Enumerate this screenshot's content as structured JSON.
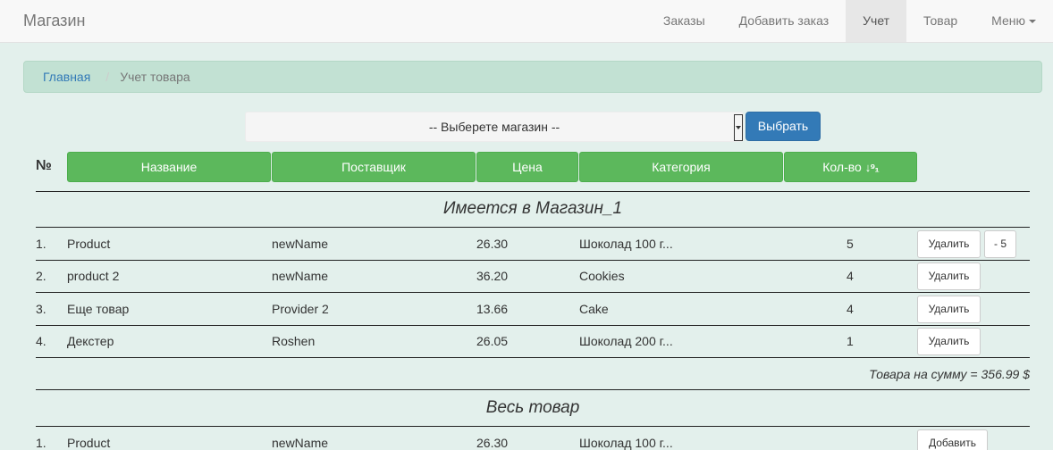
{
  "navbar": {
    "brand": "Магазин",
    "items": [
      "Заказы",
      "Добавить заказ",
      "Учет",
      "Товар",
      "Меню"
    ],
    "active": "Учет"
  },
  "breadcrumb": {
    "home": "Главная",
    "separator": "/",
    "current": "Учет товара"
  },
  "shop_select": {
    "selected": "-- Выберете магазин --"
  },
  "choose_button": "Выбрать",
  "table": {
    "number_header": "№",
    "columns": [
      "Название",
      "Поставщик",
      "Цена",
      "Категория",
      "Кол-во"
    ],
    "sort_icon": "↓⁹₁"
  },
  "section_store": {
    "title": "Имеется в Магазин_1",
    "rows": [
      {
        "num": "1.",
        "name": "Product",
        "provider": "newName",
        "price": "26.30",
        "category": "Шоколад 100 г...",
        "qty": "5",
        "delete": "Удалить",
        "minus": "- 5"
      },
      {
        "num": "2.",
        "name": "product 2",
        "provider": "newName",
        "price": "36.20",
        "category": "Cookies",
        "qty": "4",
        "delete": "Удалить"
      },
      {
        "num": "3.",
        "name": "Еще товар",
        "provider": "Provider 2",
        "price": "13.66",
        "category": "Cake",
        "qty": "4",
        "delete": "Удалить"
      },
      {
        "num": "4.",
        "name": "Декстер",
        "provider": "Roshen",
        "price": "26.05",
        "category": "Шоколад 200 г...",
        "qty": "1",
        "delete": "Удалить"
      }
    ],
    "total": "Товара на сумму = 356.99 $"
  },
  "section_all": {
    "title": "Весь товар",
    "rows": [
      {
        "num": "1.",
        "name": "Product",
        "provider": "newName",
        "price": "26.30",
        "category": "Шоколад 100 г...",
        "add": "Добавить"
      }
    ]
  },
  "colors": {
    "accent_blue": "#337ab7",
    "header_green": "#5cb85c",
    "page_bg": "#e3f0ec",
    "breadcrumb_bg": "#c2e1d3"
  }
}
